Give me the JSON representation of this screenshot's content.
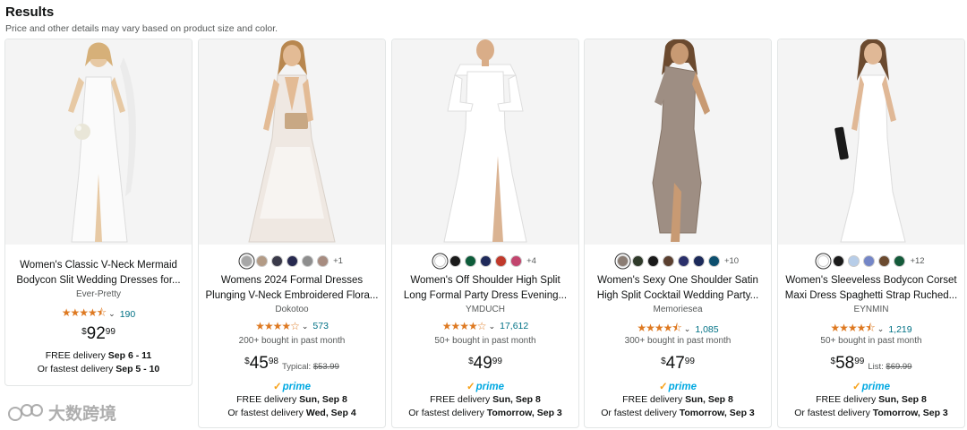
{
  "header": {
    "title": "Results",
    "subtitle": "Price and other details may vary based on product size and color."
  },
  "products": [
    {
      "swatches": [],
      "more": "",
      "title1": "Women's Classic V-Neck Mermaid",
      "title2": "Bodycon Slit Wedding Dresses for...",
      "brand": "Ever-Pretty",
      "stars": "★★★★⯪",
      "reviews": "190",
      "bought": "",
      "price_symbol": "$",
      "price_whole": "92",
      "price_fraction": "99",
      "typical_label": "",
      "typical_price": "",
      "prime": "",
      "delivery_line1_prefix": "FREE delivery ",
      "delivery_line1_bold": "Sep 6 - 11",
      "delivery_line2_prefix": "Or fastest delivery ",
      "delivery_line2_bold": "Sep 5 - 10"
    },
    {
      "swatches": [
        "#a7a7a7",
        "#b39b86",
        "#3a3a4a",
        "#27294f",
        "#8e8e8e",
        "#a78c80"
      ],
      "more": "+1",
      "title1": "Womens 2024 Formal Dresses",
      "title2": "Plunging V-Neck Embroidered Flora...",
      "brand": "Dokotoo",
      "stars": "★★★★☆",
      "reviews": "573",
      "bought": "200+ bought in past month",
      "price_symbol": "$",
      "price_whole": "45",
      "price_fraction": "98",
      "typical_label": "Typical: ",
      "typical_price": "$53.99",
      "prime": "prime",
      "delivery_line1_prefix": "FREE delivery ",
      "delivery_line1_bold": "Sun, Sep 8",
      "delivery_line2_prefix": "Or fastest delivery ",
      "delivery_line2_bold": "Wed, Sep 4"
    },
    {
      "swatches": [
        "#ffffff",
        "#1a1a1a",
        "#0d5c3a",
        "#1f2a5a",
        "#c0392b",
        "#c2456e"
      ],
      "more": "+4",
      "title1": "Women's Off Shoulder High Split",
      "title2": "Long Formal Party Dress Evening...",
      "brand": "YMDUCH",
      "stars": "★★★★☆",
      "reviews": "17,612",
      "bought": "50+ bought in past month",
      "price_symbol": "$",
      "price_whole": "49",
      "price_fraction": "99",
      "typical_label": "",
      "typical_price": "",
      "prime": "prime",
      "delivery_line1_prefix": "FREE delivery ",
      "delivery_line1_bold": "Sun, Sep 8",
      "delivery_line2_prefix": "Or fastest delivery ",
      "delivery_line2_bold": "Tomorrow, Sep 3"
    },
    {
      "swatches": [
        "#8b7d74",
        "#2f3a2a",
        "#1a1a1a",
        "#5b4030",
        "#2a2f6a",
        "#1c2a5a",
        "#0d4f6e"
      ],
      "more": "+10",
      "title1": "Women's Sexy One Shoulder Satin",
      "title2": "High Split Cocktail Wedding Party...",
      "brand": "Memoriesea",
      "stars": "★★★★⯪",
      "reviews": "1,085",
      "bought": "300+ bought in past month",
      "price_symbol": "$",
      "price_whole": "47",
      "price_fraction": "99",
      "typical_label": "",
      "typical_price": "",
      "prime": "prime",
      "delivery_line1_prefix": "FREE delivery ",
      "delivery_line1_bold": "Sun, Sep 8",
      "delivery_line2_prefix": "Or fastest delivery ",
      "delivery_line2_bold": "Tomorrow, Sep 3"
    },
    {
      "swatches": [
        "#ffffff",
        "#1a1a1a",
        "#b7cde8",
        "#7486c7",
        "#6b4a2f",
        "#145a3a"
      ],
      "more": "+12",
      "title1": "Women's Sleeveless Bodycon Corset",
      "title2": "Maxi Dress Spaghetti Strap Ruched...",
      "brand": "EYNMIN",
      "stars": "★★★★⯪",
      "reviews": "1,219",
      "bought": "50+ bought in past month",
      "price_symbol": "$",
      "price_whole": "58",
      "price_fraction": "99",
      "typical_label": "List: ",
      "typical_price": "$69.99",
      "prime": "prime",
      "delivery_line1_prefix": "FREE delivery ",
      "delivery_line1_bold": "Sun, Sep 8",
      "delivery_line2_prefix": "Or fastest delivery ",
      "delivery_line2_bold": "Tomorrow, Sep 3"
    }
  ],
  "watermark": {
    "text": "大数跨境"
  }
}
